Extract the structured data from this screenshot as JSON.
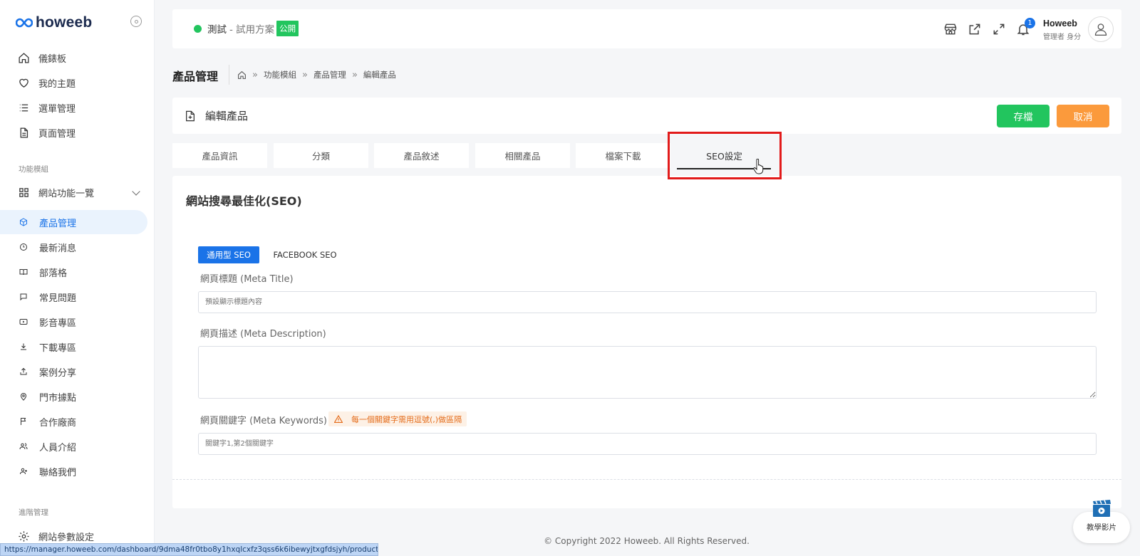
{
  "brand": {
    "name": "howeeb"
  },
  "sidebar": {
    "top_items": [
      {
        "label": "儀錶板",
        "icon": "home-icon"
      },
      {
        "label": "我的主題",
        "icon": "heart-icon"
      },
      {
        "label": "選單管理",
        "icon": "list-icon"
      },
      {
        "label": "頁面管理",
        "icon": "page-icon"
      }
    ],
    "section_modules": "功能模組",
    "modules_group": "網站功能一覽",
    "module_items": [
      {
        "label": "產品管理",
        "icon": "box-icon",
        "active": true
      },
      {
        "label": "最新消息",
        "icon": "clock-icon"
      },
      {
        "label": "部落格",
        "icon": "book-icon"
      },
      {
        "label": "常見問題",
        "icon": "chat-icon"
      },
      {
        "label": "影音專區",
        "icon": "video-icon"
      },
      {
        "label": "下載專區",
        "icon": "download-icon"
      },
      {
        "label": "案例分享",
        "icon": "share-icon"
      },
      {
        "label": "門市據點",
        "icon": "pin-icon"
      },
      {
        "label": "合作廠商",
        "icon": "flag-icon"
      },
      {
        "label": "人員介紹",
        "icon": "users-icon"
      },
      {
        "label": "聯絡我們",
        "icon": "contact-icon"
      }
    ],
    "section_advanced": "進階管理",
    "settings_item": "網站參數設定"
  },
  "topbar": {
    "site_name": "測試",
    "plan": "- 試用方案",
    "public_badge": "公開",
    "notification_count": "1",
    "user_name": "Howeeb",
    "user_role": "管理者 身分"
  },
  "header": {
    "page_title": "產品管理",
    "breadcrumb": [
      "功能模組",
      "產品管理",
      "編輯產品"
    ]
  },
  "edit_card": {
    "title": "編輯產品",
    "save_label": "存檔",
    "cancel_label": "取消"
  },
  "tabs": [
    "產品資訊",
    "分類",
    "產品敘述",
    "相關產品",
    "檔案下載",
    "SEO設定"
  ],
  "seo": {
    "title": "網站搜尋最佳化(SEO)",
    "subtab_general": "通用型 SEO",
    "subtab_facebook": "FACEBOOK SEO",
    "meta_title_label": "網頁標題 (Meta Title)",
    "meta_title_placeholder": "預設顯示標題內容",
    "meta_desc_label": "網頁描述 (Meta Description)",
    "meta_keywords_label": "網頁關鍵字 (Meta Keywords)",
    "keywords_warning": "每一個關鍵字需用逗號(,)做區隔",
    "meta_keywords_placeholder": "關鍵字1,第2個關鍵字"
  },
  "footer": {
    "copyright": "© Copyright 2022 Howeeb. All Rights Reserved."
  },
  "status_url": "https://manager.howeeb.com/dashboard/9dma48fr0tbo8y1hxqlcxfz3qss6k6ibewyjtxgfdsjyh/products/516/e...",
  "tutorial": {
    "label": "教學影片"
  },
  "colors": {
    "accent": "#1a73e8",
    "success": "#22c55e",
    "warning": "#fb9a3c",
    "highlight": "#e21b1b"
  }
}
